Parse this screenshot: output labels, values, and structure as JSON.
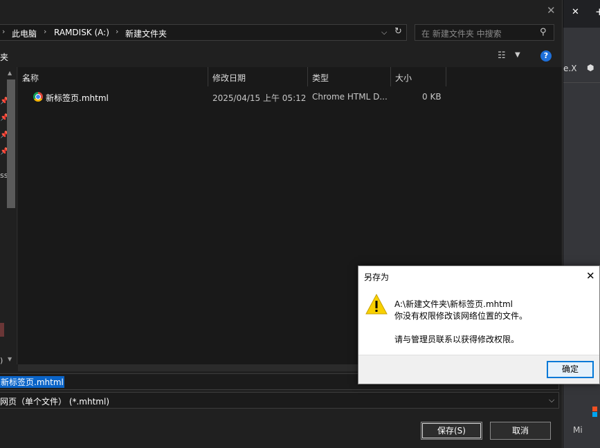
{
  "background_window": {
    "close_glyph": "✕",
    "new_tab_glyph": "+",
    "ext_text": "e.X",
    "footer_text": "Mi"
  },
  "save_dialog": {
    "close_glyph": "✕",
    "breadcrumb": [
      "此电脑",
      "RAMDISK (A:)",
      "新建文件夹"
    ],
    "search_placeholder": "在 新建文件夹 中搜索",
    "toolbar_partial_text": "夹",
    "nav_partial_labels": [
      "ss",
      ")"
    ],
    "columns": [
      "名称",
      "修改日期",
      "类型",
      "大小"
    ],
    "files": [
      {
        "name": "新标签页.mhtml",
        "modified": "2025/04/15 上午 05:12",
        "type": "Chrome HTML D...",
        "size": "0 KB"
      }
    ],
    "filename_value": "新标签页.mhtml",
    "filetype_value": "网页（单个文件） (*.mhtml)",
    "save_button": "保存(S)",
    "cancel_button": "取消"
  },
  "alert": {
    "title": "另存为",
    "path": "A:\\新建文件夹\\新标签页.mhtml",
    "message1": "你没有权限修改该网络位置的文件。",
    "message2": "请与管理员联系以获得修改权限。",
    "ok_button": "确定"
  },
  "colors": {
    "dialog_bg": "#202020",
    "selection_blue": "#0a64c8",
    "alert_ok_border": "#0078d7",
    "warning_yellow": "#f8d000"
  }
}
